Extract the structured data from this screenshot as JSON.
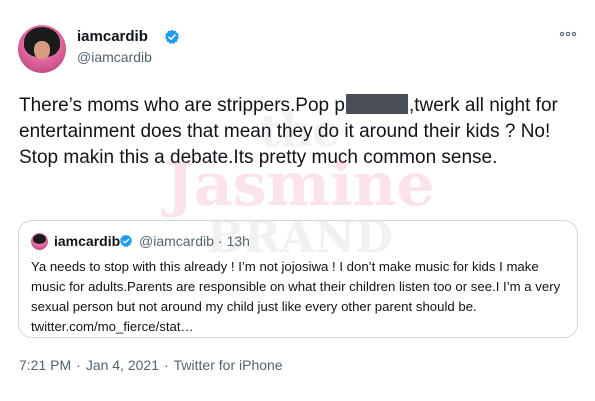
{
  "tweet": {
    "author": {
      "name": "iamcardib",
      "handle": "@iamcardib",
      "verified": true
    },
    "text_part1": "There’s moms who are strippers.Pop p",
    "text_part2": ",twerk all night for entertainment does that mean they do it around their kids ? No! Stop makin this a debate.Its pretty much common sense.",
    "quoted": {
      "name": "iamcardib",
      "handle": "@iamcardib",
      "separator": "·",
      "time_ago": "13h",
      "text": "Ya needs to stop with this already ! I’m not jojosiwa ! I don’t make music for kids I make music for adults.Parents are responsible on what their children listen too or see.I I’m a very sexual person but not around my child just like every other parent should be. twitter.com/mo_fierce/stat…"
    },
    "footer": {
      "time": "7:21 PM",
      "sep1": "·",
      "date": "Jan 4, 2021",
      "sep2": "·",
      "client": "Twitter for iPhone"
    },
    "watermark": {
      "line1": "the",
      "line2": "Jasmine",
      "line3": "BRAND"
    }
  },
  "icons": {
    "verified": "verified-badge-icon",
    "more": "more-options-icon"
  },
  "colors": {
    "verified_blue": "#1d9bf0",
    "secondary_text": "#536471",
    "border": "#cfd9de",
    "redaction": "#4a4e57"
  }
}
